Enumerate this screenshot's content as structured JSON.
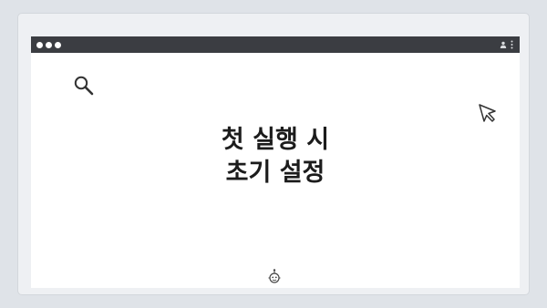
{
  "heading": {
    "line1": "첫 실행 시",
    "line2": "초기 설정"
  },
  "icons": {
    "search": "search-icon",
    "cursor": "cursor-icon",
    "user": "user-icon",
    "menu": "kebab-menu-icon",
    "bot": "bot-icon"
  },
  "colors": {
    "titlebar": "#3b3d42",
    "background": "#dfe3e8",
    "window": "#ffffff",
    "text": "#1c1c1c"
  }
}
